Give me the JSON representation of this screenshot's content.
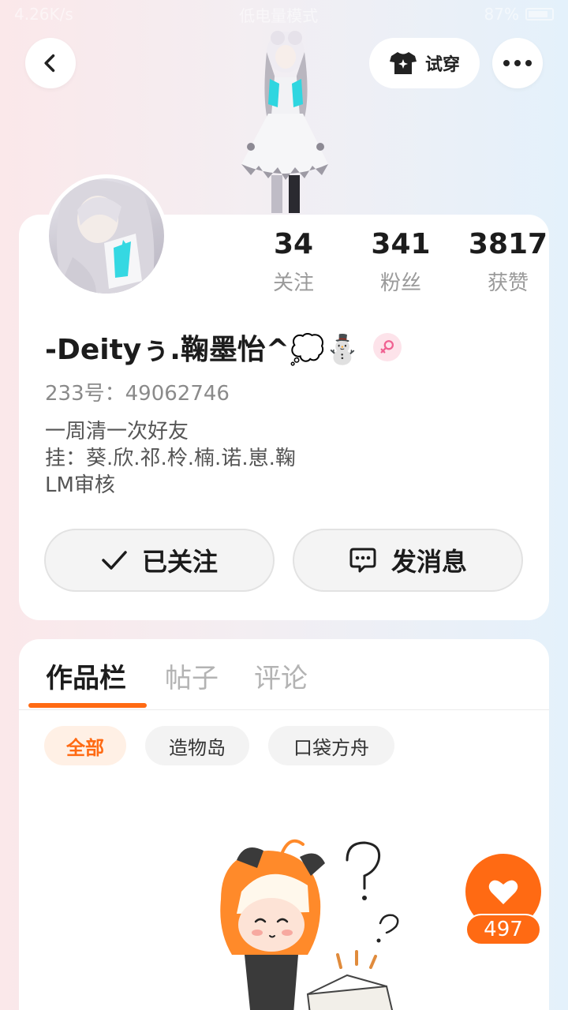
{
  "status_bar": {
    "network_speed": "4.26K/s",
    "mode": "低电量模式",
    "battery": "87%"
  },
  "header": {
    "back_icon": "chevron-left-icon",
    "try_on_label": "试穿",
    "try_on_icon": "shirt-sparkle-icon",
    "more_icon": "more-dots-icon"
  },
  "profile": {
    "stats": [
      {
        "value": "34",
        "label": "关注"
      },
      {
        "value": "341",
        "label": "粉丝"
      },
      {
        "value": "3817",
        "label": "获赞"
      }
    ],
    "nickname": "-Deityぅ.鞠墨怡^💭⛄",
    "gender": "female",
    "uid": "233号：49062746",
    "bio": [
      "一周清一次好友",
      "挂：葵.欣.祁.柃.楠.诺.崽.鞠",
      "LM审核"
    ],
    "follow_button": "已关注",
    "message_button": "发消息"
  },
  "works": {
    "tabs": [
      {
        "label": "作品栏",
        "active": true
      },
      {
        "label": "帖子",
        "active": false
      },
      {
        "label": "评论",
        "active": false
      }
    ],
    "chips": [
      {
        "label": "全部",
        "active": true
      },
      {
        "label": "造物岛",
        "active": false
      },
      {
        "label": "口袋方舟",
        "active": false
      }
    ]
  },
  "like_fab": {
    "count": "497",
    "icon": "heart-icon"
  },
  "colors": {
    "accent": "#ff6a13",
    "card": "#ffffff",
    "muted": "#9a9a9a"
  }
}
